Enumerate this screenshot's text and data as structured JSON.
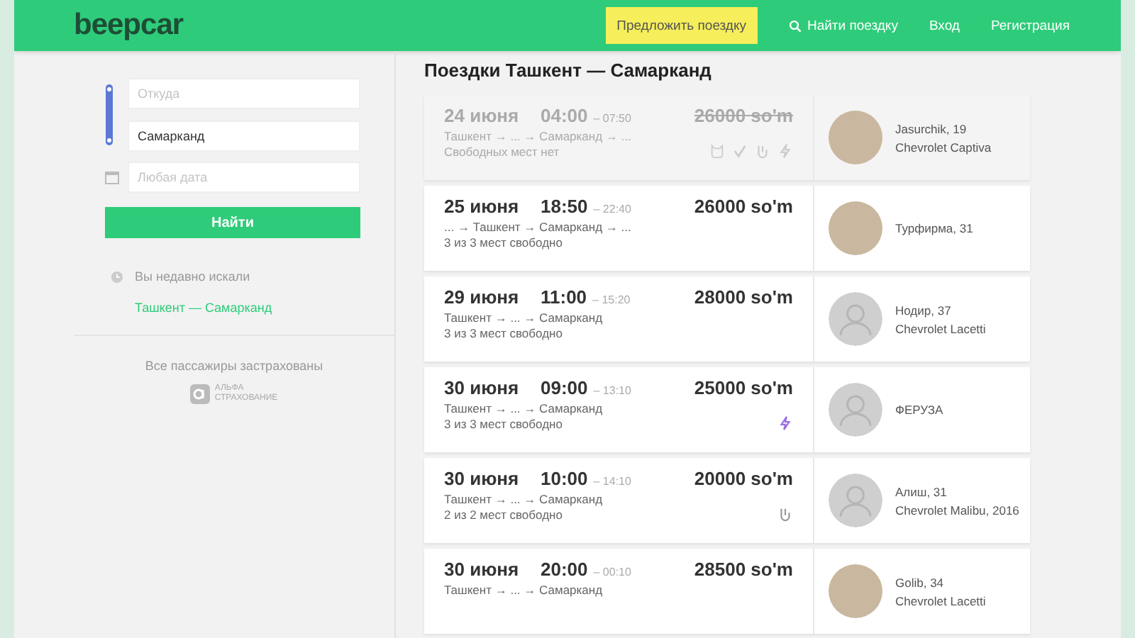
{
  "header": {
    "logo": "beepcar",
    "offer_button": "Предложить поездку",
    "nav": [
      {
        "label": "Найти поездку",
        "kind": "search"
      },
      {
        "label": "Вход",
        "kind": "link"
      },
      {
        "label": "Регистрация",
        "kind": "link"
      }
    ]
  },
  "search": {
    "from": {
      "placeholder": "Откуда"
    },
    "to": {
      "value": "Самарканд"
    },
    "date": {
      "placeholder": "Любая дата"
    },
    "button": "Найти"
  },
  "recent": {
    "label": "Вы недавно искали",
    "items": [
      "Ташкент — Самарканд"
    ]
  },
  "insurance": {
    "text": "Все пассажиры застрахованы",
    "logo_lines": [
      "АЛЬФА",
      "СТРАХОВАНИЕ"
    ]
  },
  "title": "Поездки Ташкент — Самарканд",
  "trips": [
    {
      "date": "24 июня",
      "depart": "04:00",
      "arrive": "– 07:50",
      "route": "Ташкент → ... → Самарканд → ...",
      "seats": "Свободных мест нет",
      "price": "26000 so'm",
      "sold_out": true,
      "amenities": [
        {
          "kind": "cat"
        },
        {
          "kind": "check"
        },
        {
          "kind": "hand"
        },
        {
          "kind": "bolt"
        }
      ],
      "driver": {
        "name": "Jasurchik, 19",
        "car": "Chevrolet Captiva",
        "avatar": {
          "kind": "photo"
        }
      }
    },
    {
      "date": "25 июня",
      "depart": "18:50",
      "arrive": "– 22:40",
      "route": "... → Ташкент → Самарканд → ...",
      "seats": "3 из 3 мест свободно",
      "price": "26000 so'm",
      "sold_out": false,
      "driver": {
        "name": "Турфирма, 31",
        "avatar": {
          "kind": "photo"
        }
      }
    },
    {
      "date": "29 июня",
      "depart": "11:00",
      "arrive": "– 15:20",
      "route": "Ташкент → ... → Самарканд",
      "seats": "3 из 3 мест свободно",
      "price": "28000 so'm",
      "sold_out": false,
      "driver": {
        "name": "Нодир, 37",
        "car": "Chevrolet Lacetti",
        "avatar": {
          "kind": "placeholder"
        }
      }
    },
    {
      "date": "30 июня",
      "depart": "09:00",
      "arrive": "– 13:10",
      "route": "Ташкент → ... → Самарканд",
      "seats": "3 из 3 мест свободно",
      "price": "25000 so'm",
      "sold_out": false,
      "amenities": [
        {
          "kind": "bolt"
        }
      ],
      "driver": {
        "name": "ФЕРУЗА",
        "avatar": {
          "kind": "placeholder"
        }
      }
    },
    {
      "date": "30 июня",
      "depart": "10:00",
      "arrive": "– 14:10",
      "route": "Ташкент → ... → Самарканд",
      "seats": "2 из 2 мест свободно",
      "price": "20000 so'm",
      "sold_out": false,
      "amenities": [
        {
          "kind": "hand"
        }
      ],
      "driver": {
        "name": "Алиш, 31",
        "car": "Chevrolet Malibu, 2016",
        "avatar": {
          "kind": "placeholder"
        }
      }
    },
    {
      "date": "30 июня",
      "depart": "20:00",
      "arrive": "– 00:10",
      "route": "Ташкент → ... → Самарканд",
      "price": "28500 so'm",
      "sold_out": false,
      "driver": {
        "name": "Golib, 34",
        "car": "Chevrolet Lacetti",
        "avatar": {
          "kind": "photo"
        }
      }
    }
  ]
}
